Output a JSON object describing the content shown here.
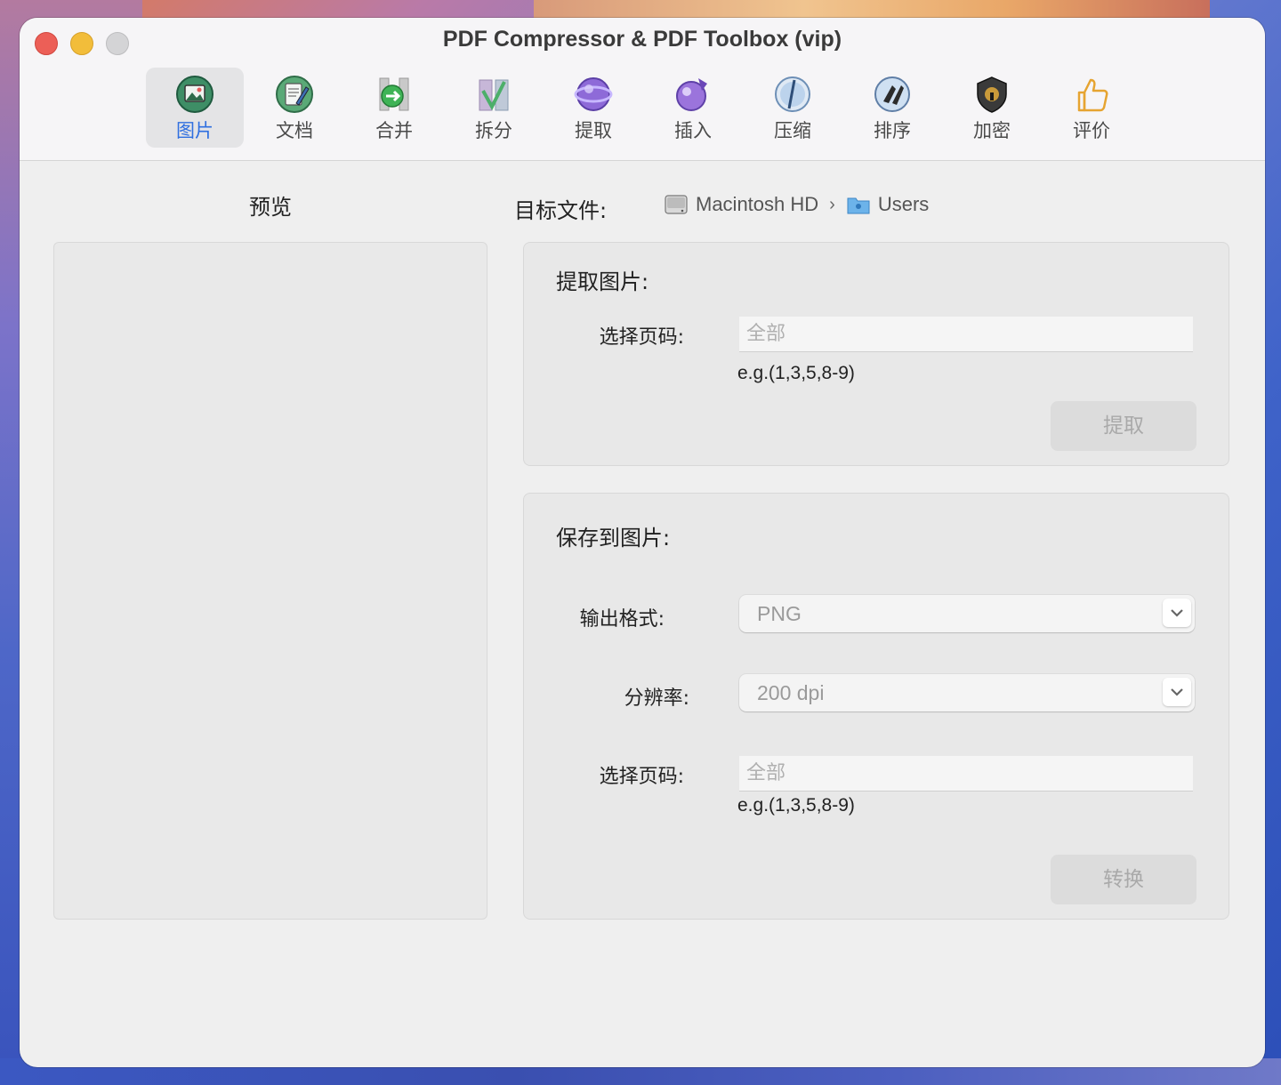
{
  "window": {
    "title": "PDF Compressor & PDF Toolbox (vip)"
  },
  "toolbar": {
    "items": [
      {
        "label": "图片",
        "icon": "image-icon",
        "active": true
      },
      {
        "label": "文档",
        "icon": "document-edit-icon",
        "active": false
      },
      {
        "label": "合并",
        "icon": "merge-icon",
        "active": false
      },
      {
        "label": "拆分",
        "icon": "split-icon",
        "active": false
      },
      {
        "label": "提取",
        "icon": "extract-icon",
        "active": false
      },
      {
        "label": "插入",
        "icon": "insert-icon",
        "active": false
      },
      {
        "label": "压缩",
        "icon": "compress-icon",
        "active": false
      },
      {
        "label": "排序",
        "icon": "sort-icon",
        "active": false
      },
      {
        "label": "加密",
        "icon": "lock-icon",
        "active": false
      },
      {
        "label": "评价",
        "icon": "thumbs-up-icon",
        "active": false
      }
    ],
    "active_color": "#2f6fe0"
  },
  "preview": {
    "title": "预览"
  },
  "target": {
    "label": "目标文件:",
    "path": [
      {
        "name": "Macintosh HD",
        "icon": "hard-drive-icon"
      },
      {
        "name": "Users",
        "icon": "folder-icon"
      }
    ]
  },
  "extract_panel": {
    "title": "提取图片:",
    "pages_label": "选择页码:",
    "pages_placeholder": "全部",
    "pages_hint": "e.g.(1,3,5,8-9)",
    "button": "提取"
  },
  "save_panel": {
    "title": "保存到图片:",
    "format_label": "输出格式:",
    "format_value": "PNG",
    "resolution_label": "分辨率:",
    "resolution_value": "200 dpi",
    "pages_label": "选择页码:",
    "pages_placeholder": "全部",
    "pages_hint": "e.g.(1,3,5,8-9)",
    "button": "转换"
  }
}
